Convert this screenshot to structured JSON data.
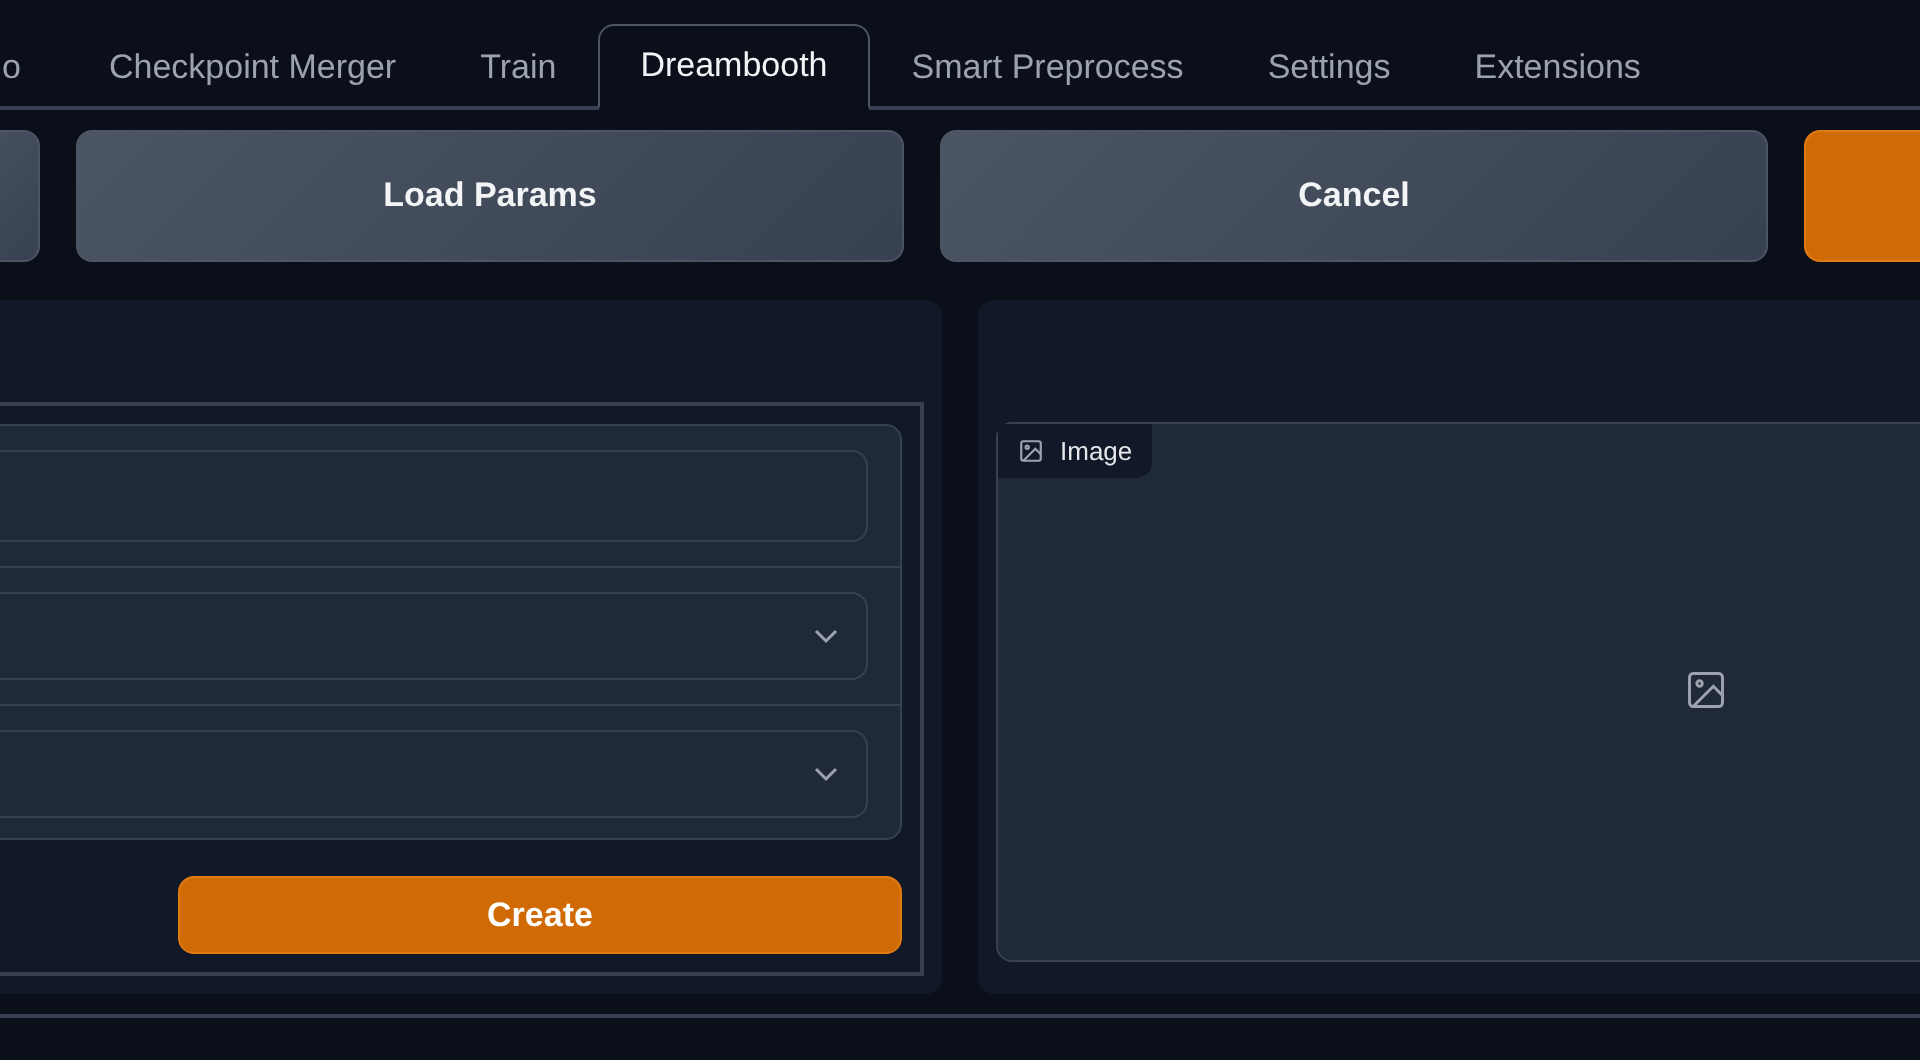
{
  "tabs": [
    {
      "label": "o",
      "selected": false
    },
    {
      "label": "Checkpoint Merger",
      "selected": false
    },
    {
      "label": "Train",
      "selected": false
    },
    {
      "label": "Dreambooth",
      "selected": true
    },
    {
      "label": "Smart Preprocess",
      "selected": false
    },
    {
      "label": "Settings",
      "selected": false
    },
    {
      "label": "Extensions",
      "selected": false
    }
  ],
  "buttons": [
    {
      "kind": "secondary"
    },
    {
      "kind": "secondary",
      "label": "Load Params"
    },
    {
      "kind": "secondary",
      "label": "Cancel"
    },
    {
      "kind": "primary"
    }
  ],
  "left_panel": {
    "fields": [
      {
        "kind": "text"
      },
      {
        "kind": "dropdown"
      },
      {
        "kind": "dropdown"
      }
    ],
    "create_button": {
      "label": "Create"
    }
  },
  "right_panel": {
    "image_box": {
      "label": "Image"
    }
  }
}
